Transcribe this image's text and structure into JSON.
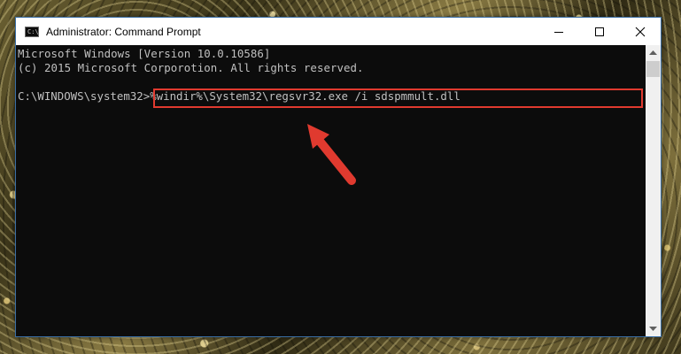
{
  "window": {
    "title": "Administrator: Command Prompt",
    "icon_text": "C:\\"
  },
  "console": {
    "line1": "Microsoft Windows [Version 10.0.10586]",
    "line2": "(c) 2015 Microsoft Corporotion. All rights reserved.",
    "prompt": "C:\\WINDOWS\\system32>",
    "command": "%windir%\\System32\\regsvr32.exe /i sdspmmult.dll"
  },
  "colors": {
    "console_bg": "#0c0c0c",
    "console_text": "#c0c0c0",
    "highlight": "#e03a2f"
  },
  "icons": {
    "minimize": "minimize-icon",
    "maximize": "maximize-icon",
    "close": "close-icon",
    "pointer": "red-arrow-icon"
  }
}
